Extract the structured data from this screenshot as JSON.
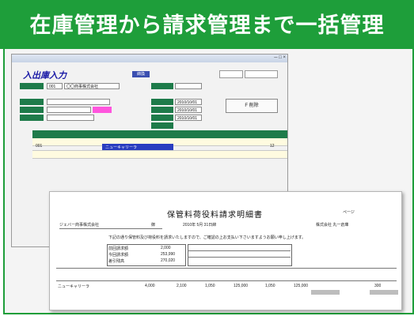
{
  "banner": {
    "title": "在庫管理から請求管理まで一括管理",
    "bg": "#1e9e3a"
  },
  "back_window": {
    "form_title": "入出庫入力",
    "badge": "締換",
    "fields": {
      "code": "001",
      "partner": "〇〇商事株式会社",
      "date1": "2010/10/01",
      "date2": "2010/10/01",
      "date3": "2010/10/01"
    },
    "button": "F 削除",
    "grid_row1": {
      "code": "001",
      "name": "ニューキャリーラ",
      "qty": "12"
    }
  },
  "doc": {
    "title": "保管料荷役料請求明細書",
    "page_label": "ページ",
    "date_line": "2010年 5月 31日締",
    "customer": "ジェバー商事株式会社",
    "honorific": "御",
    "sender": "株式会社 丸一倉庫",
    "notice": "下記の通り保管料及び荷役料を請求いたしますので、ご確認の上お支払い下さいますようお願い申し上げます。",
    "total_rows": [
      {
        "label": "前回請求額",
        "value": "2,000"
      },
      {
        "label": "今回請求額",
        "value": "253,990"
      },
      {
        "label": "差引残高",
        "value": "270,020"
      }
    ],
    "row1": [
      "ニューキャリーラ",
      "4,000",
      "2,100",
      "1,050",
      "125,000",
      "1,050",
      "125,000",
      "300"
    ]
  }
}
